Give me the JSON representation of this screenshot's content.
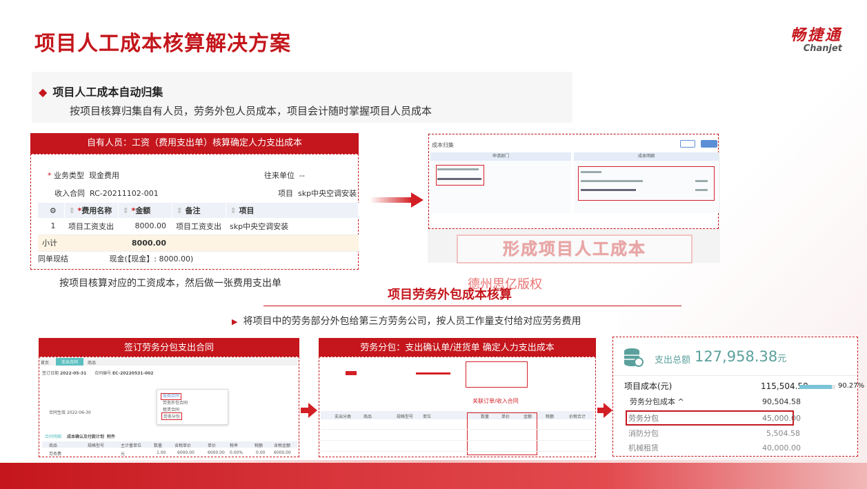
{
  "title": "项目人工成本核算解决方案",
  "logo": {
    "cn": "畅捷通",
    "en": "Chanjet"
  },
  "section1": {
    "heading": "项目人工成本自动归集",
    "desc": "按项目核算归集自有人员，劳务外包人员成本，项目会计随时掌握项目人员成本"
  },
  "panel_salary": {
    "header": "自有人员：工资（费用支出单）核算确定人力支出成本",
    "business_type_label": "业务类型",
    "business_type_value": "现金费用",
    "counterparty_label": "往来单位",
    "counterparty_value": "--",
    "contract_label": "收入合同",
    "contract_value": "RC-20211102-001",
    "project_label": "项目",
    "project_value": "skp中央空调安装",
    "columns": [
      "费用名称",
      "金额",
      "备注",
      "项目"
    ],
    "rows": [
      [
        "1",
        "项目工资支出",
        "8000.00",
        "项目工资支出",
        "skp中央空调安装"
      ]
    ],
    "subtotal_label": "小计",
    "subtotal_value": "8000.00",
    "settle_label": "同单现结",
    "settle_value": "现金(【现金】: 8000.00)"
  },
  "caption_salary": "按项目核算对应的工资成本，然后做一张费用支出单",
  "panel_cost": {
    "window_title": "成本归集",
    "col_left": "申请部门",
    "col_right": "成本明细",
    "stamp": "形成项目人工成本"
  },
  "watermark": "德州思亿版权",
  "section2": {
    "heading": "项目劳务外包成本核算",
    "desc": "将项目中的劳务部分外包给第三方劳务公司，按人员工作量支付给对应劳务费用"
  },
  "panel_contract": {
    "header": "签订劳务分包支出合同",
    "tabs": [
      "首页",
      "支出合同",
      "商品"
    ],
    "date_label": "签订日期",
    "date_value": "2022-05-31",
    "code_label": "合同编号",
    "code_value": "EC-20220531-002",
    "start_label": "合同生效",
    "start_value": "2022-06-30",
    "menu_items": [
      "采购合同",
      "劳务外包合同",
      "租赁合同",
      "劳务分包"
    ],
    "subtabs": [
      "合同明细",
      "成本确认及付款计划",
      "附件"
    ],
    "grid_cols": [
      "商品",
      "规格型号",
      "主计量单位",
      "数量",
      "含税单价",
      "单价",
      "税率",
      "税额",
      "含税金额"
    ],
    "grid_row": [
      "劳务费",
      "",
      "元",
      "1.00",
      "6000.00",
      "6000.00",
      "0.00%",
      "0.00",
      "6000.00"
    ]
  },
  "panel_confirm": {
    "header": "劳务分包：支出确认单/进货单 确定人力支出成本",
    "link_label": "关联订单/收入合同",
    "col_headers": [
      "支出分类",
      "商品",
      "规格型号",
      "单位",
      "数量",
      "单价",
      "金额",
      "税额",
      "价税合计"
    ]
  },
  "panel_total": {
    "total_label": "支出总额",
    "total_value": "127,958.38",
    "total_unit": "元",
    "lines": [
      {
        "label": "项目成本(元)",
        "value": "115,504.58",
        "pct": "90.27%"
      },
      {
        "label": "劳务分包成本 ^",
        "value": "90,504.58"
      },
      {
        "label": "劳务分包",
        "value": "45,000.00"
      },
      {
        "label": "消防分包",
        "value": "5,504.58"
      },
      {
        "label": "机械租赁",
        "value": "40,000.00"
      }
    ],
    "progress": 0.9027
  }
}
